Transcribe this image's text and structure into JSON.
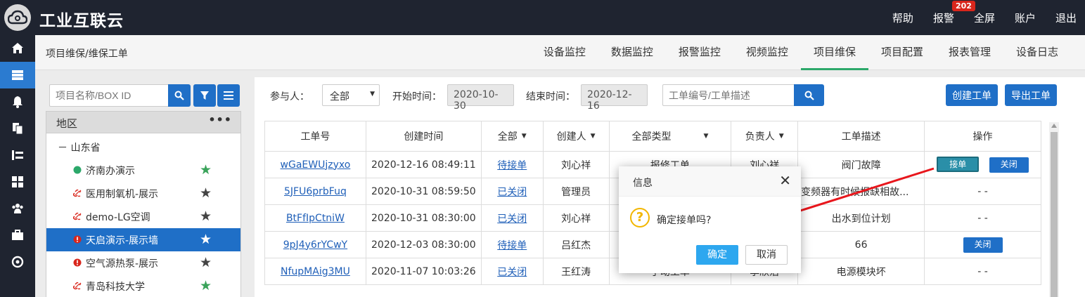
{
  "app": {
    "title": "工业互联云"
  },
  "topnav": {
    "help": "帮助",
    "alarm": "报警",
    "alarm_count": "202",
    "fullscreen": "全屏",
    "account": "账户",
    "logout": "退出"
  },
  "rail_icons": [
    "home-icon",
    "server-icon",
    "bell-icon",
    "copy-icon",
    "tools-icon",
    "grid-icon",
    "users-icon",
    "briefcase-icon",
    "shield-icon"
  ],
  "breadcrumb": "项目维保/维保工单",
  "tabs": [
    {
      "label": "设备监控"
    },
    {
      "label": "数据监控"
    },
    {
      "label": "报警监控"
    },
    {
      "label": "视频监控"
    },
    {
      "label": "项目维保",
      "active": true
    },
    {
      "label": "项目配置"
    },
    {
      "label": "报表管理"
    },
    {
      "label": "设备日志"
    }
  ],
  "leftpanel": {
    "search_placeholder": "项目名称/BOX ID",
    "region_label": "地区",
    "region_menu": "•••",
    "province": "山东省",
    "province_toggle": "－",
    "items": [
      {
        "label": "济南办演示",
        "status": "online",
        "starred": true
      },
      {
        "label": "医用制氧机-展示",
        "status": "offline",
        "starred": false
      },
      {
        "label": "demo-LG空调",
        "status": "offline",
        "starred": false
      },
      {
        "label": "天启演示-展示墙",
        "status": "alarm",
        "starred": false,
        "selected": true
      },
      {
        "label": "空气源热泵-展示",
        "status": "alarm",
        "starred": false
      },
      {
        "label": "青岛科技大学",
        "status": "offline",
        "starred": true
      }
    ]
  },
  "filters": {
    "participant_label": "参与人：",
    "participant_value": "全部",
    "start_label": "开始时间：",
    "start_value": "2020-10-30",
    "end_label": "结束时间：",
    "end_value": "2020-12-16",
    "search_placeholder": "工单编号/工单描述",
    "create_button": "创建工单",
    "export_button": "导出工单"
  },
  "table": {
    "headers": [
      "工单号",
      "创建时间",
      "全部",
      "创建人",
      "全部类型",
      "负责人",
      "工单描述",
      "操作"
    ],
    "rows": [
      {
        "id": "wGaEWUjzyxo",
        "created": "2020-12-16 08:49:11",
        "status": "待接单",
        "creator": "刘心祥",
        "type": "报修工单",
        "owner": "刘心祥",
        "desc": "阀门故障",
        "actions": [
          "接单",
          "关闭"
        ]
      },
      {
        "id": "5JFU6prbFuq",
        "created": "2020-10-31 08:59:50",
        "status": "已关闭",
        "creator": "管理员",
        "type": "",
        "owner": "",
        "desc": "变频器有时候报缺相故...",
        "actions": [
          "- -"
        ]
      },
      {
        "id": "BtFfIpCtniW",
        "created": "2020-10-31 08:30:00",
        "status": "已关闭",
        "creator": "刘心祥",
        "type": "",
        "owner": "",
        "desc": "出水到位计划",
        "actions": [
          "- -"
        ]
      },
      {
        "id": "9pJ4y6rYCwY",
        "created": "2020-12-03 08:30:00",
        "status": "待接单",
        "creator": "吕红杰",
        "type": "",
        "owner": "",
        "desc": "66",
        "actions": [
          "关闭"
        ]
      },
      {
        "id": "NfupMAig3MU",
        "created": "2020-11-07 10:03:26",
        "status": "已关闭",
        "creator": "王红涛",
        "type": "手动工单",
        "owner": "李欣治",
        "desc": "电源模块坏",
        "actions": [
          "- -"
        ]
      }
    ]
  },
  "dialog": {
    "title": "信息",
    "close": "✕",
    "icon": "?",
    "message": "确定接单吗?",
    "ok": "确定",
    "cancel": "取消"
  },
  "colors": {
    "primary": "#1f6fc7",
    "dark": "#1f2430",
    "accent_green": "#2ca86a",
    "alarm_red": "#d9261c",
    "arrow_red": "#e8161c"
  }
}
